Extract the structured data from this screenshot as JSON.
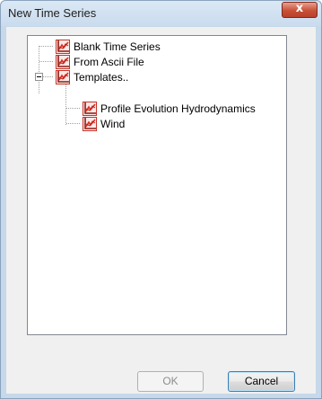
{
  "dialog": {
    "title": "New Time Series",
    "close_glyph": "x"
  },
  "tree": {
    "items": [
      {
        "label": "Blank Time Series",
        "icon": "time-series-chart-icon"
      },
      {
        "label": "From Ascii File",
        "icon": "time-series-chart-icon"
      },
      {
        "label": "Templates..",
        "icon": "time-series-chart-icon",
        "expanded": true
      },
      {
        "label": "Profile Evolution Hydrodynamics",
        "icon": "time-series-chart-icon"
      },
      {
        "label": "Wind",
        "icon": "time-series-chart-icon"
      }
    ]
  },
  "buttons": {
    "ok_label": "OK",
    "cancel_label": "Cancel"
  }
}
